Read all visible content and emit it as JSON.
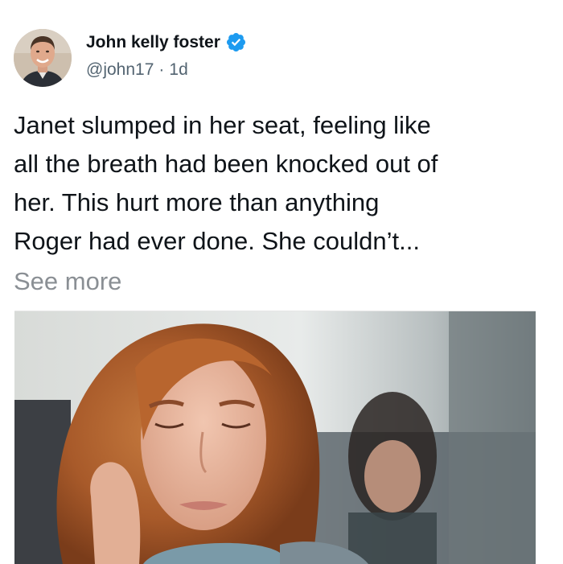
{
  "post": {
    "author": {
      "display_name": "John kelly foster",
      "handle": "@john17",
      "separator": "·",
      "time": "1d",
      "verified": true,
      "verified_color": "#1d9bf0"
    },
    "text_lines": [
      "Janet slumped in her seat, feeling like",
      "all the breath had been knocked out of",
      "her. This hurt more than anything",
      "Roger had ever done. She couldn’t..."
    ],
    "see_more": "See more",
    "colors": {
      "text": "#0f1419",
      "secondary": "#536471",
      "see_more": "#8a8f94"
    }
  }
}
